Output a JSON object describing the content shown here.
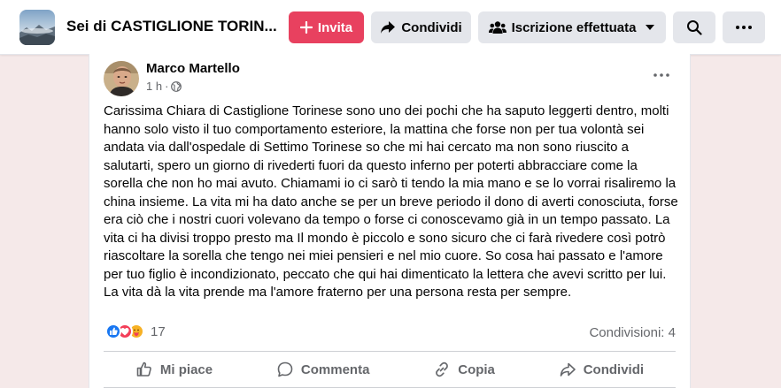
{
  "header": {
    "group_name": "Sei di CASTIGLIONE TORIN...",
    "invite_label": "Invita",
    "share_label": "Condividi",
    "joined_label": "Iscrizione effettuata"
  },
  "post": {
    "author": "Marco Martello",
    "time": "1 h",
    "text": "Carissima Chiara di Castiglione Torinese sono uno dei pochi che ha saputo leggerti dentro, molti hanno solo visto il tuo comportamento esteriore, la mattina che forse non per tua volontà sei andata via dall'ospedale di Settimo Torinese so che mi hai cercato ma non sono riuscito a salutarti, spero un giorno di rivederti fuori da questo inferno per poterti abbracciare come la sorella che non ho mai avuto. Chiamami io ci sarò ti tendo la mia mano e se lo vorrai risaliremo la china insieme. La vita mi ha dato anche se per un breve periodo il dono di averti conosciuta, forse era ciò che i nostri cuori volevano da tempo o forse ci conoscevamo già in un tempo passato. La vita ci ha divisi troppo presto ma Il mondo è piccolo e sono sicuro che ci farà rivedere così potrò riascoltare la sorella che tengo nei miei pensieri e nel  mio cuore. So cosa hai passato e l'amore per tuo figlio è incondizionato, peccato che qui hai dimenticato la lettera che avevi scritto per lui. La vita dà la vita prende ma l'amore fraterno per una persona resta per sempre.",
    "reaction_count": "17",
    "shares": "Condivisioni: 4"
  },
  "actions": {
    "like": "Mi piace",
    "comment": "Commenta",
    "copy": "Copia",
    "share": "Condividi"
  },
  "colors": {
    "accent": "#e8415f",
    "like_blue": "#1877f2",
    "love_red": "#f33e58",
    "care_yellow": "#f7b125"
  }
}
